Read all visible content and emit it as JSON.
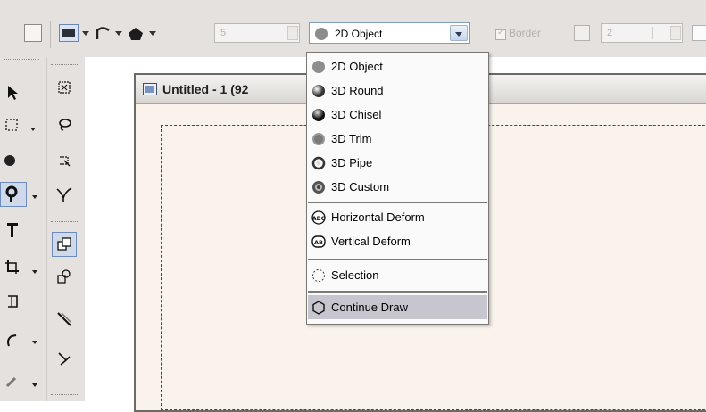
{
  "toolbar": {
    "stroke_width_value": "5",
    "object_type_selected": "2D Object",
    "border_label": "Border",
    "border_width_value": "2"
  },
  "document": {
    "title": "Untitled - 1 (92"
  },
  "dropdown": {
    "items": [
      {
        "label": "2D Object",
        "icon": "flat-circle-icon"
      },
      {
        "label": "3D Round",
        "icon": "sphere-icon"
      },
      {
        "label": "3D Chisel",
        "icon": "chisel-sphere-icon"
      },
      {
        "label": "3D Trim",
        "icon": "trim-sphere-icon"
      },
      {
        "label": "3D Pipe",
        "icon": "pipe-ring-icon"
      },
      {
        "label": "3D Custom",
        "icon": "custom-sphere-icon"
      },
      {
        "label": "Horizontal Deform",
        "icon": "horizontal-deform-icon"
      },
      {
        "label": "Vertical Deform",
        "icon": "vertical-deform-icon"
      },
      {
        "label": "Selection",
        "icon": "dashed-selection-icon"
      },
      {
        "label": "Continue Draw",
        "icon": "continue-draw-icon"
      }
    ],
    "selected": "Continue Draw"
  },
  "colors": {
    "toolbar_bg": "#e4e1de",
    "canvas_bg": "#f9f3ec",
    "highlight": "#c7c5cd",
    "combo_border": "#7f9db9"
  }
}
